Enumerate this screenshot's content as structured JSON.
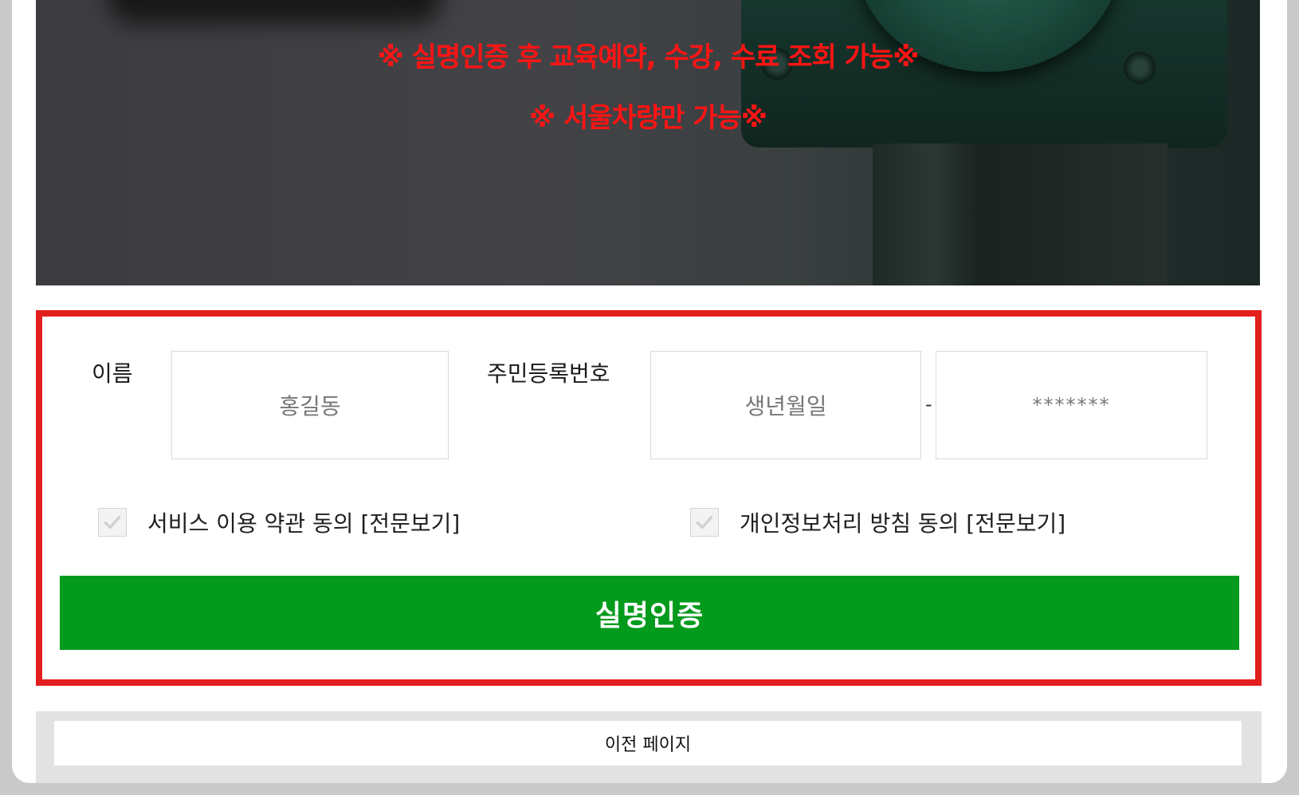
{
  "hero": {
    "notice_line1": "※ 실명인증 후 교육예약, 수강, 수료 조회 가능※",
    "notice_line2": "※ 서울차량만 가능※"
  },
  "form": {
    "name_label": "이름",
    "name_placeholder": "홍길동",
    "rrn_label": "주민등록번호",
    "rrn_front_placeholder": "생년월일",
    "rrn_separator": "-",
    "rrn_back_placeholder": "*******",
    "agree_terms_label": "서비스 이용 약관 동의 [전문보기]",
    "agree_privacy_label": "개인정보처리 방침 동의 [전문보기]",
    "submit_label": "실명인증"
  },
  "footer": {
    "prev_page_label": "이전 페이지"
  },
  "colors": {
    "accent_green": "#049b1c",
    "border_red": "#e31e1e",
    "notice_red": "#ff1414"
  }
}
